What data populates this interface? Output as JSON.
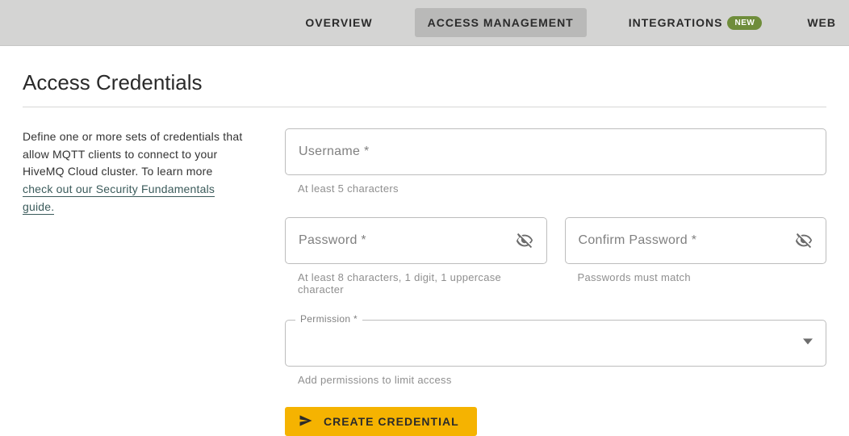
{
  "nav": {
    "overview": "OVERVIEW",
    "access_management": "ACCESS MANAGEMENT",
    "integrations": "INTEGRATIONS",
    "integrations_badge": "NEW",
    "web_trail": "WEB"
  },
  "page": {
    "title": "Access Credentials",
    "intro_text": "Define one or more sets of credentials that allow MQTT clients to connect to your HiveMQ Cloud cluster. To learn more ",
    "intro_link": "check out our Security Fundamentals guide."
  },
  "form": {
    "username": {
      "label": "Username *",
      "helper": "At least 5 characters"
    },
    "password": {
      "label": "Password *",
      "helper": "At least 8 characters, 1 digit, 1 uppercase character"
    },
    "confirm": {
      "label": "Confirm Password *",
      "helper": "Passwords must match"
    },
    "permission": {
      "legend": "Permission *",
      "helper": "Add permissions to limit access"
    },
    "submit": "CREATE CREDENTIAL"
  }
}
